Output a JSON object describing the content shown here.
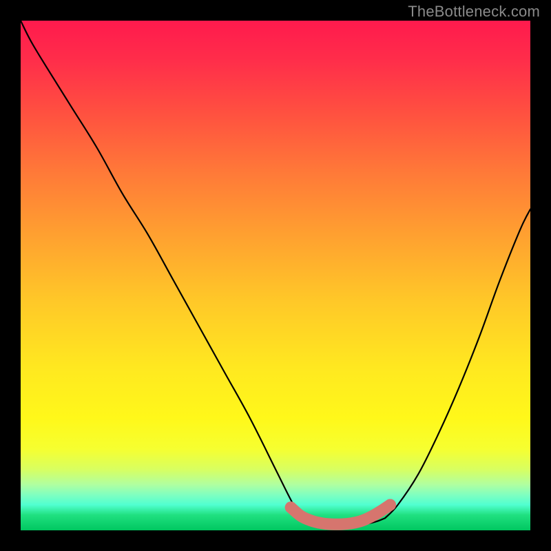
{
  "watermark": "TheBottleneck.com",
  "chart_data": {
    "type": "line",
    "title": "",
    "xlabel": "",
    "ylabel": "",
    "xlim": [
      0,
      100
    ],
    "ylim": [
      0,
      100
    ],
    "grid": false,
    "legend": false,
    "annotations": [],
    "series": [
      {
        "name": "left-curve",
        "color": "#000000",
        "x": [
          0,
          2,
          5,
          10,
          15,
          20,
          25,
          30,
          35,
          40,
          45,
          50,
          53,
          55,
          56.5
        ],
        "y": [
          100,
          96,
          91,
          83,
          75,
          66,
          58,
          49,
          40,
          31,
          22,
          12,
          6,
          2.5,
          1.8
        ]
      },
      {
        "name": "flat-bottom",
        "color": "#000000",
        "x": [
          56.5,
          58,
          60,
          62,
          64,
          66,
          68,
          70,
          71.5
        ],
        "y": [
          1.8,
          1.3,
          1.0,
          0.9,
          0.9,
          1.0,
          1.3,
          1.8,
          2.4
        ]
      },
      {
        "name": "right-curve",
        "color": "#000000",
        "x": [
          71.5,
          74,
          78,
          82,
          86,
          90,
          94,
          98,
          100
        ],
        "y": [
          2.4,
          5,
          11,
          19,
          28,
          38,
          49,
          59,
          63
        ]
      },
      {
        "name": "highlight-band",
        "color": "#d6756e",
        "style": "thick-rounded",
        "x": [
          53,
          55,
          57,
          59,
          61,
          63,
          65,
          67,
          69,
          71,
          72.5
        ],
        "y": [
          4.5,
          2.8,
          1.9,
          1.4,
          1.2,
          1.2,
          1.4,
          1.9,
          2.8,
          4.0,
          5.0
        ]
      }
    ]
  }
}
